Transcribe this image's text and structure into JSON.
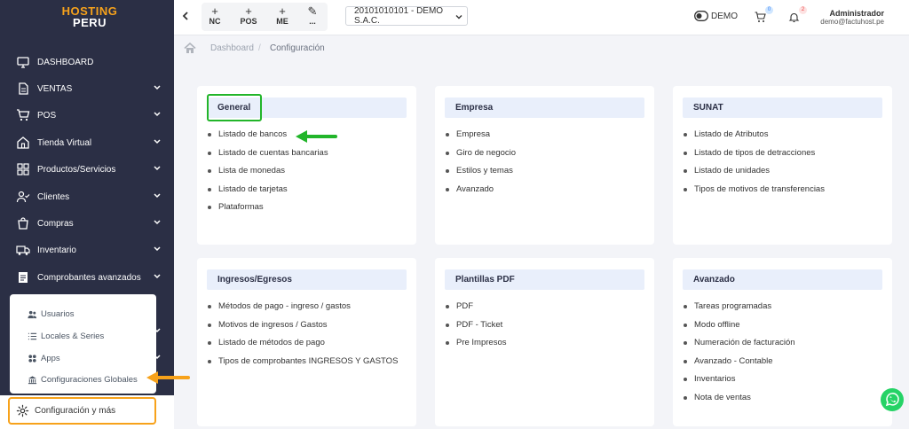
{
  "brand": {
    "line1": "HOSTING",
    "line2": "PERU"
  },
  "sidebar": {
    "items": [
      {
        "label": "DASHBOARD",
        "icon": "monitor-icon",
        "chevron": false
      },
      {
        "label": "VENTAS",
        "icon": "document-icon",
        "chevron": true
      },
      {
        "label": "POS",
        "icon": "cart-icon",
        "chevron": true
      },
      {
        "label": "Tienda Virtual",
        "icon": "store-icon",
        "chevron": true
      },
      {
        "label": "Productos/Servicios",
        "icon": "grid-icon",
        "chevron": true
      },
      {
        "label": "Clientes",
        "icon": "user-check-icon",
        "chevron": true
      },
      {
        "label": "Compras",
        "icon": "shopping-bag-icon",
        "chevron": true
      },
      {
        "label": "Inventario",
        "icon": "truck-icon",
        "chevron": true
      },
      {
        "label": "Comprobantes avanzados",
        "icon": "file-text-icon",
        "chevron": true
      }
    ],
    "submenu": [
      {
        "label": "Usuarios",
        "icon": "users-icon"
      },
      {
        "label": "Locales & Series",
        "icon": "list-icon"
      },
      {
        "label": "Apps",
        "icon": "apps-icon"
      },
      {
        "label": "Configuraciones Globales",
        "icon": "bank-icon"
      }
    ],
    "config_label": "Configuración y más"
  },
  "topbar": {
    "quick_actions": [
      {
        "symbol": "+",
        "label": "NC"
      },
      {
        "symbol": "+",
        "label": "POS"
      },
      {
        "symbol": "+",
        "label": "ME"
      },
      {
        "symbol": "✎",
        "label": "..."
      }
    ],
    "company": "20101010101 - DEMO S.A.C.",
    "mode_label": "DEMO",
    "cart_count": "0",
    "notification_count": "2",
    "user_name": "Administrador",
    "user_email": "demo@factuhost.pe"
  },
  "breadcrumb": {
    "root": "Dashboard",
    "separator": "/",
    "current": "Configuración"
  },
  "cards": [
    {
      "title": "General",
      "items": [
        "Listado de bancos",
        "Listado de cuentas bancarias",
        "Lista de monedas",
        "Listado de tarjetas",
        "Plataformas"
      ]
    },
    {
      "title": "Empresa",
      "items": [
        "Empresa",
        "Giro de negocio",
        "Estilos y temas",
        "Avanzado"
      ]
    },
    {
      "title": "SUNAT",
      "items": [
        "Listado de Atributos",
        "Listado de tipos de detracciones",
        "Listado de unidades",
        "Tipos de motivos de transferencias"
      ]
    },
    {
      "title": "Ingresos/Egresos",
      "items": [
        "Métodos de pago - ingreso / gastos",
        "Motivos de ingresos / Gastos",
        "Listado de métodos de pago",
        "Tipos de comprobantes INGRESOS Y GASTOS"
      ]
    },
    {
      "title": "Plantillas PDF",
      "items": [
        "PDF",
        "PDF - Ticket",
        "Pre Impresos"
      ]
    },
    {
      "title": "Avanzado",
      "items": [
        "Tareas programadas",
        "Modo offline",
        "Numeración de facturación",
        "Avanzado - Contable",
        "Inventarios",
        "Nota de ventas"
      ]
    }
  ],
  "colors": {
    "sidebar": "#2b2f45",
    "accent_orange": "#f7a21b",
    "highlight_green": "#22b52a",
    "card_header": "#e9effb"
  }
}
